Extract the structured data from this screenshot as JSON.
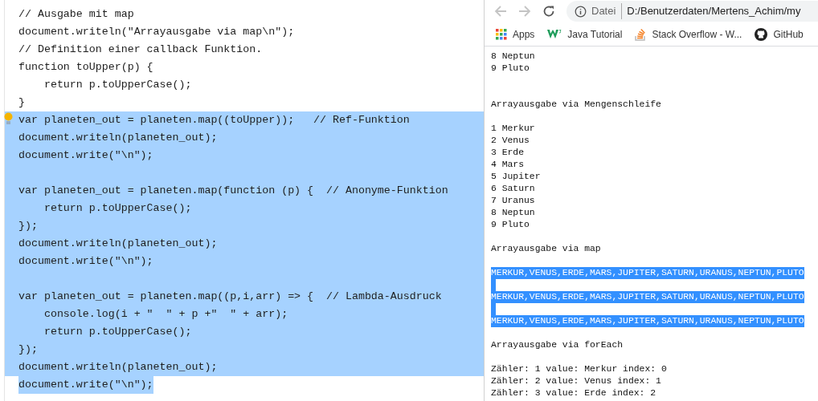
{
  "editor": {
    "lines": [
      {
        "text": "// Ausgabe mit map",
        "selected": false
      },
      {
        "text": "document.writeln(\"Arrayausgabe via map\\n\");",
        "selected": false
      },
      {
        "text": "// Definition einer callback Funktion.",
        "selected": false
      },
      {
        "text": "function toUpper(p) {",
        "selected": false
      },
      {
        "text": "    return p.toUpperCase();",
        "selected": false
      },
      {
        "text": "}",
        "selected": false
      },
      {
        "text": "var planeten_out = planeten.map((toUpper));   // Ref-Funktion",
        "selected": true,
        "bulb": true
      },
      {
        "text": "document.writeln(planeten_out);",
        "selected": true
      },
      {
        "text": "document.write(\"\\n\");",
        "selected": true
      },
      {
        "selected": true
      },
      {
        "text": "var planeten_out = planeten.map(function (p) {  // Anonyme-Funktion",
        "selected": true
      },
      {
        "text": "    return p.toUpperCase();",
        "selected": true
      },
      {
        "text": "});",
        "selected": true
      },
      {
        "text": "document.writeln(planeten_out);",
        "selected": true
      },
      {
        "text": "document.write(\"\\n\");",
        "selected": true
      },
      {
        "selected": true
      },
      {
        "text": "var planeten_out = planeten.map((p,i,arr) => {  // Lambda-Ausdruck",
        "selected": true
      },
      {
        "text": "    console.log(i + \"  \" + p +\"  \" + arr);",
        "selected": true
      },
      {
        "text": "    return p.toUpperCase();",
        "selected": true
      },
      {
        "text": "});",
        "selected": true
      },
      {
        "text": "document.writeln(planeten_out);",
        "selected": true
      },
      {
        "text": "document.write(\"\\n\");",
        "selected": true,
        "selection_ends_at_text": true
      }
    ]
  },
  "browser": {
    "address": {
      "scheme": "Datei",
      "url": "D:/Benutzerdaten/Mertens_Achim/my"
    },
    "bookmarks": [
      {
        "kind": "apps",
        "label": "Apps"
      },
      {
        "kind": "w3",
        "label": "Java Tutorial"
      },
      {
        "kind": "stack",
        "label": "Stack Overflow - W..."
      },
      {
        "kind": "github",
        "label": "GitHub"
      }
    ],
    "output": [
      {
        "text": "8 Neptun",
        "selected": false
      },
      {
        "text": "9 Pluto",
        "selected": false
      },
      {
        "selected": false
      },
      {
        "selected": false
      },
      {
        "text": "Arrayausgabe via Mengenschleife",
        "selected": false
      },
      {
        "selected": false
      },
      {
        "text": "1 Merkur",
        "selected": false
      },
      {
        "text": "2 Venus",
        "selected": false
      },
      {
        "text": "3 Erde",
        "selected": false
      },
      {
        "text": "4 Mars",
        "selected": false
      },
      {
        "text": "5 Jupiter",
        "selected": false
      },
      {
        "text": "6 Saturn",
        "selected": false
      },
      {
        "text": "7 Uranus",
        "selected": false
      },
      {
        "text": "8 Neptun",
        "selected": false
      },
      {
        "text": "9 Pluto",
        "selected": false
      },
      {
        "selected": false
      },
      {
        "text": "Arrayausgabe via map",
        "selected": false
      },
      {
        "selected": false
      },
      {
        "text": "MERKUR,VENUS,ERDE,MARS,JUPITER,SATURN,URANUS,NEPTUN,PLUTO",
        "selected": true
      },
      {
        "selected": true
      },
      {
        "text": "MERKUR,VENUS,ERDE,MARS,JUPITER,SATURN,URANUS,NEPTUN,PLUTO",
        "selected": true
      },
      {
        "selected": true
      },
      {
        "text": "MERKUR,VENUS,ERDE,MARS,JUPITER,SATURN,URANUS,NEPTUN,PLUTO",
        "selected": true
      },
      {
        "selected": false
      },
      {
        "text": "Arrayausgabe via forEach",
        "selected": false
      },
      {
        "selected": false
      },
      {
        "text": "Zähler: 1 value: Merkur index: 0",
        "selected": false
      },
      {
        "text": "Zähler: 2 value: Venus index: 1",
        "selected": false
      },
      {
        "text": "Zähler: 3 value: Erde index: 2",
        "selected": false
      }
    ]
  }
}
